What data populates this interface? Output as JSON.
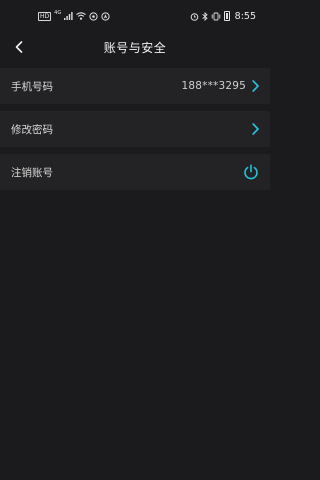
{
  "status_bar": {
    "hd_badge": "HD",
    "network": "4G",
    "time": "8:55"
  },
  "header": {
    "title": "账号与安全",
    "back_icon": "chevron-left-icon"
  },
  "rows": {
    "phone": {
      "label": "手机号码",
      "value": "188***3295",
      "icon": "chevron-right-icon"
    },
    "password": {
      "label": "修改密码",
      "icon": "chevron-right-icon"
    },
    "cancel_account": {
      "label": "注销账号",
      "icon": "power-icon"
    }
  },
  "colors": {
    "background": "#1b1b1d",
    "row_background": "#232325",
    "accent": "#25c3d8"
  }
}
